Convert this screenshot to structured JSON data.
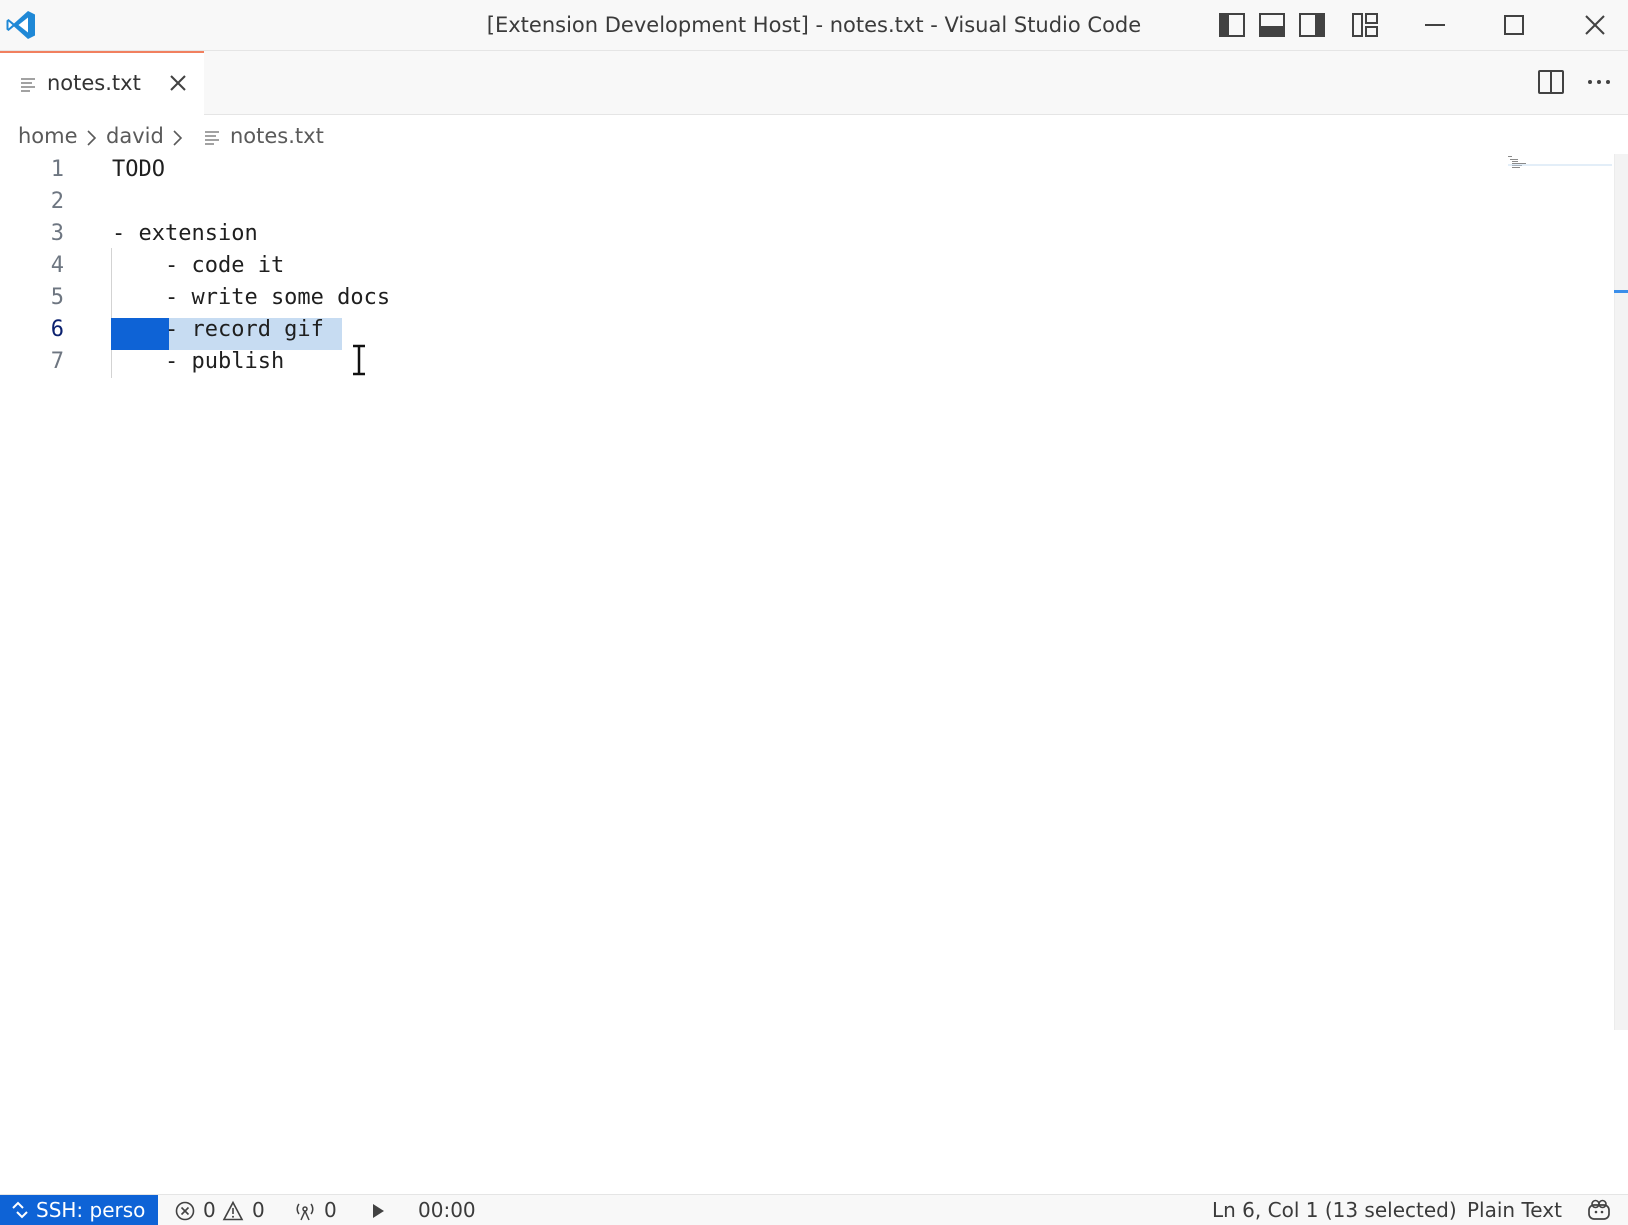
{
  "window": {
    "title": "[Extension Development Host] - notes.txt - Visual Studio Code",
    "icons": [
      "toggle-primary-sidebar-icon",
      "toggle-panel-icon",
      "toggle-secondary-sidebar-icon",
      "customize-layout-icon",
      "minimize-icon",
      "maximize-icon",
      "close-icon"
    ]
  },
  "tabs": [
    {
      "label": "notes.txt",
      "active": true,
      "icon": "text-file-icon"
    }
  ],
  "breadcrumb": {
    "items": [
      "home",
      "david",
      "notes.txt"
    ]
  },
  "editor": {
    "active_line": 6,
    "lines": [
      {
        "number": "1",
        "text": "TODO"
      },
      {
        "number": "2",
        "text": ""
      },
      {
        "number": "3",
        "text": "- extension"
      },
      {
        "number": "4",
        "text": "    - code it"
      },
      {
        "number": "5",
        "text": "    - write some docs"
      },
      {
        "number": "6",
        "text": "    - record gif"
      },
      {
        "number": "7",
        "text": "    - publish"
      }
    ],
    "selection_color": "#0e63d6",
    "selection_light_color": "#c7dcf2"
  },
  "status": {
    "remote": "SSH: perso",
    "errors": "0",
    "warnings": "0",
    "ports": "0",
    "timer": "00:00",
    "cursor": "Ln 6, Col 1 (13 selected)",
    "language": "Plain Text",
    "accent": "#0e63d6"
  }
}
